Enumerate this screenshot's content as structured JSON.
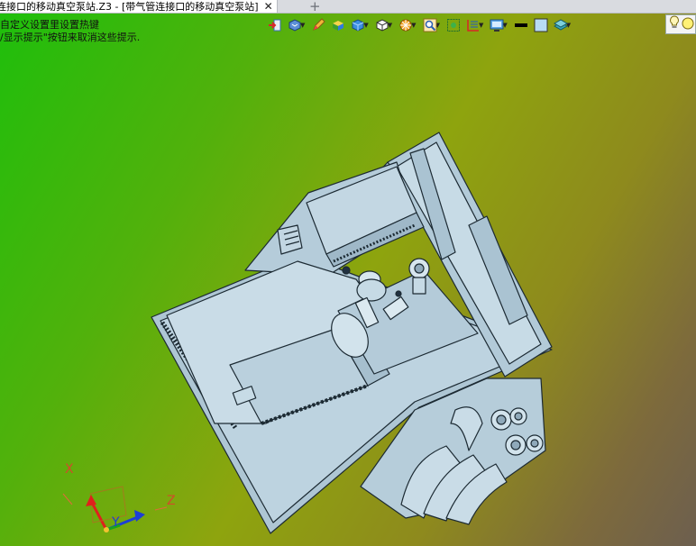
{
  "window": {
    "tab_title": "连接口的移动真空泵站.Z3 - [带气管连接口的移动真空泵站]",
    "close_glyph": "✕",
    "add_glyph": "+"
  },
  "hints": {
    "line1": "自定义设置里设置热键",
    "line2": "/显示提示\"按钮来取消这些提示."
  },
  "toolbar": {
    "items": [
      {
        "icon": "import-icon",
        "dropdown": false
      },
      {
        "icon": "view-orient-icon",
        "dropdown": true
      },
      {
        "icon": "pencil-icon",
        "dropdown": false
      },
      {
        "icon": "shaded-solid-icon",
        "dropdown": false
      },
      {
        "icon": "cube-blue-icon",
        "dropdown": true
      },
      {
        "icon": "cube-white-icon",
        "dropdown": true
      },
      {
        "icon": "section-view-icon",
        "dropdown": true
      },
      {
        "icon": "zoom-icon",
        "dropdown": true
      },
      {
        "icon": "zoom-fit-icon",
        "dropdown": false
      },
      {
        "icon": "sketch-grid-icon",
        "dropdown": true
      },
      {
        "icon": "display-settings-icon",
        "dropdown": true
      },
      {
        "icon": "line-color-icon",
        "dropdown": false
      },
      {
        "icon": "face-color-icon",
        "dropdown": false
      },
      {
        "icon": "layer-icon",
        "dropdown": true
      }
    ],
    "end_icons": [
      "lightbulb-icon",
      "light-circle-icon"
    ]
  },
  "triad": {
    "x_label": "X",
    "z_label": "Z",
    "y_label": "Y"
  },
  "colors": {
    "bg_top_left": "#1dbf0c",
    "bg_bottom_right": "#6d5f4f",
    "model_fill": "#b9cfdc",
    "model_edge": "#1c2a33",
    "axis_x": "#e0201c",
    "axis_y": "#1aa51a",
    "axis_z": "#1d3fd6"
  }
}
